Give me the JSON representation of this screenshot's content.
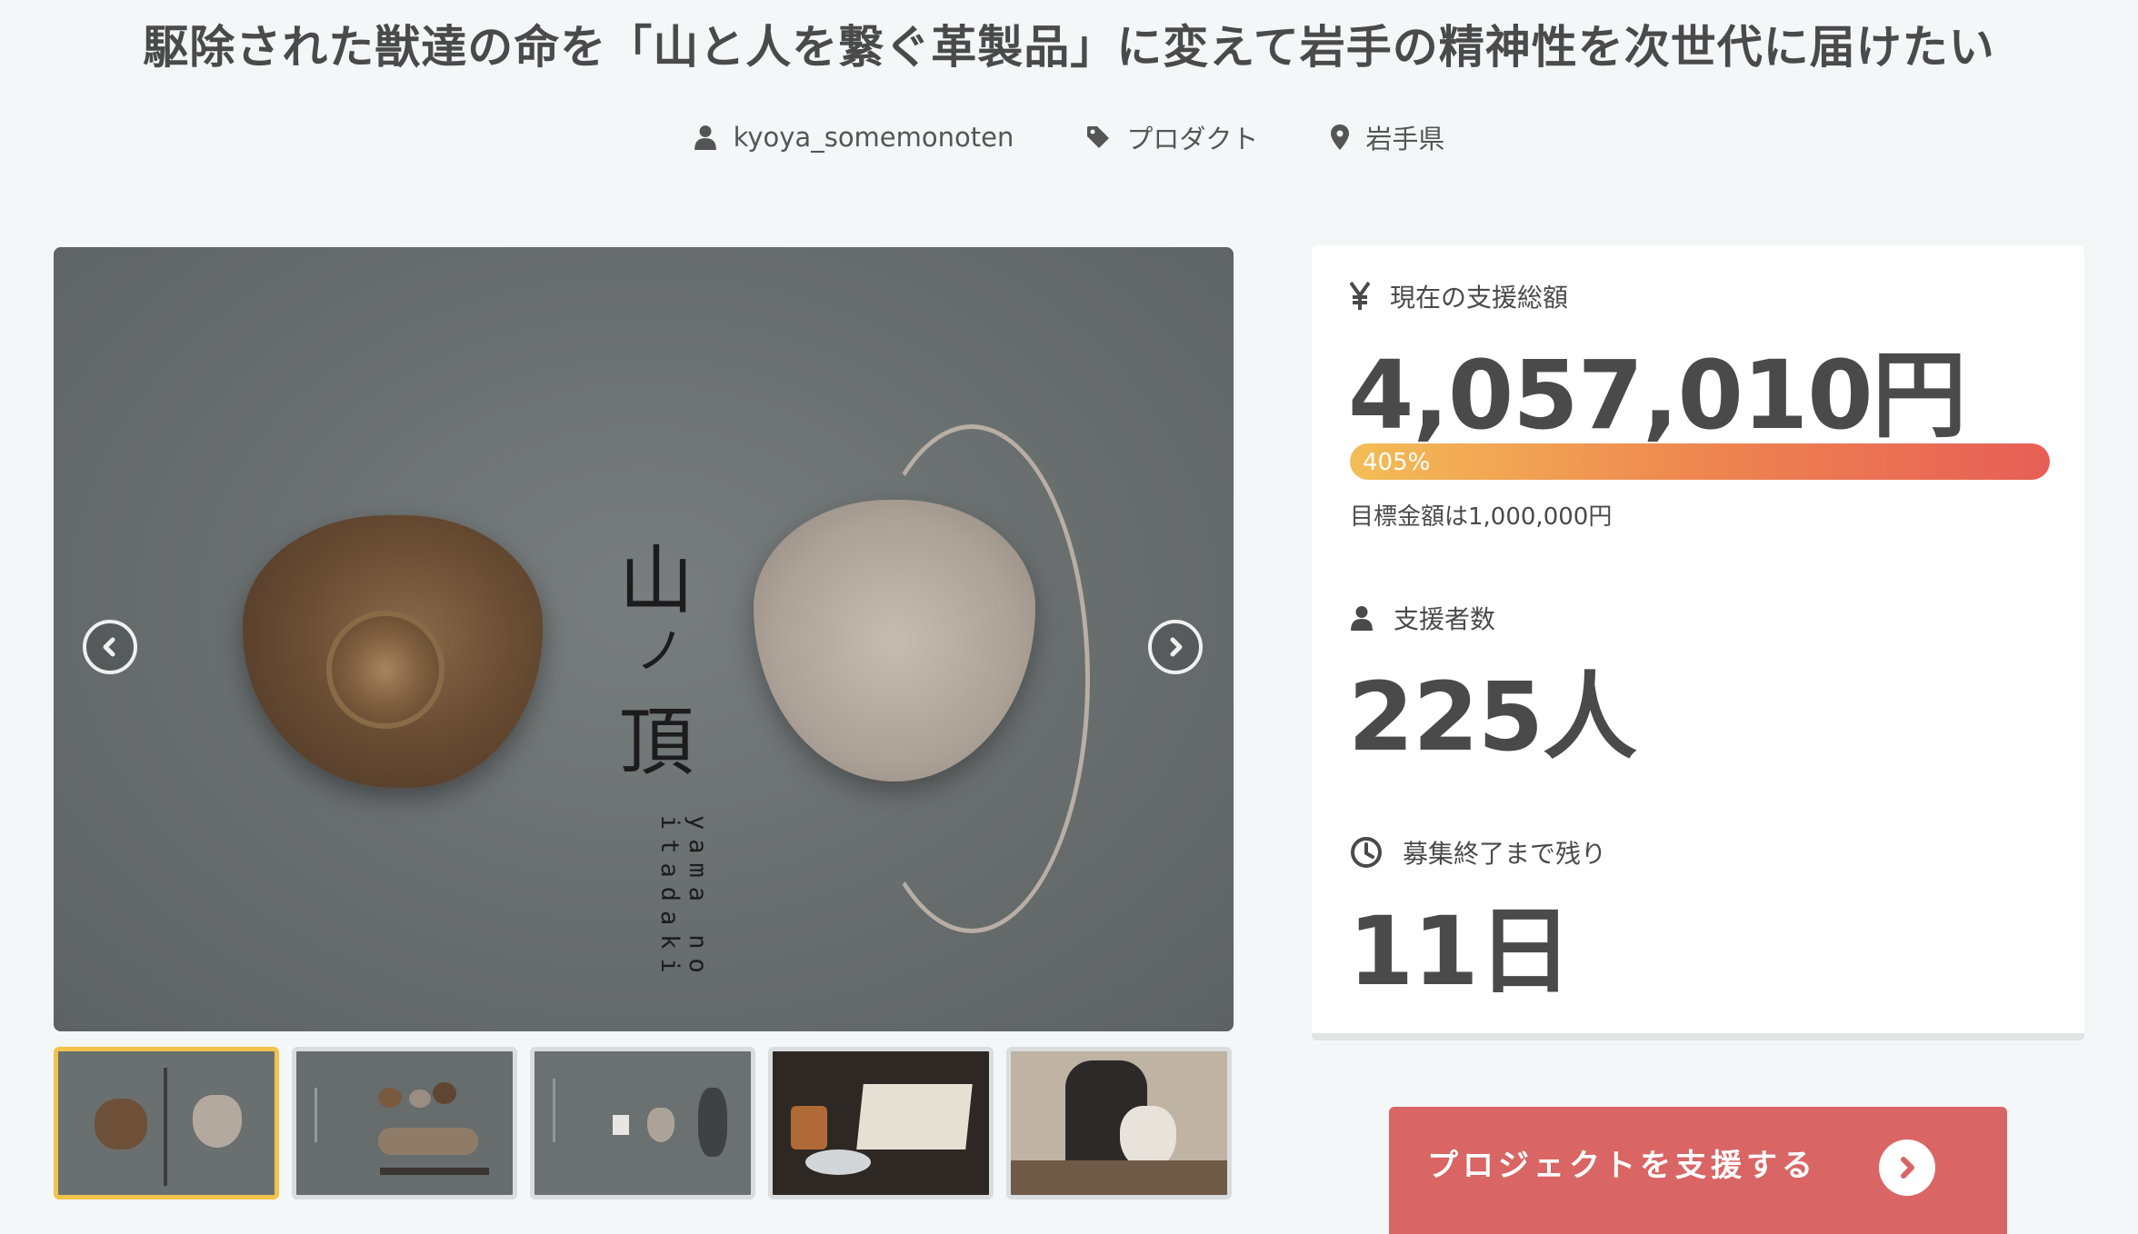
{
  "project": {
    "title": "駆除された獣達の命を「山と人を繋ぐ革製品」に変えて岩手の精神性を次世代に届けたい",
    "owner": "kyoya_somemonoten",
    "category": "プロダクト",
    "location": "岩手県"
  },
  "gallery": {
    "logo_kanji_1": "山",
    "logo_kanji_2": "ノ",
    "logo_kanji_3": "頂",
    "logo_roman": "yama no itadaki",
    "active_index": 0,
    "thumb_count": 5
  },
  "stats": {
    "amount_label": "現在の支援総額",
    "amount_value": "4,057,010円",
    "progress_percent": 405,
    "progress_label": "405%",
    "goal_text": "目標金額は1,000,000円",
    "backers_label": "支援者数",
    "backers_value": "225人",
    "remaining_label": "募集終了まで残り",
    "remaining_value": "11日"
  },
  "cta": {
    "support_label": "プロジェクトを支援する"
  },
  "icons": {
    "owner": "user-icon",
    "category": "tag-icon",
    "location": "map-pin-icon",
    "amount": "yen-icon",
    "backers": "user-icon",
    "remaining": "clock-icon",
    "prev": "chevron-left-icon",
    "next": "chevron-right-icon",
    "cta": "chevron-right-circle-icon"
  },
  "colors": {
    "accent": "#d96565",
    "progress_start": "#f3bd56",
    "progress_end": "#e75e56",
    "thumb_active": "#f2c24a"
  }
}
